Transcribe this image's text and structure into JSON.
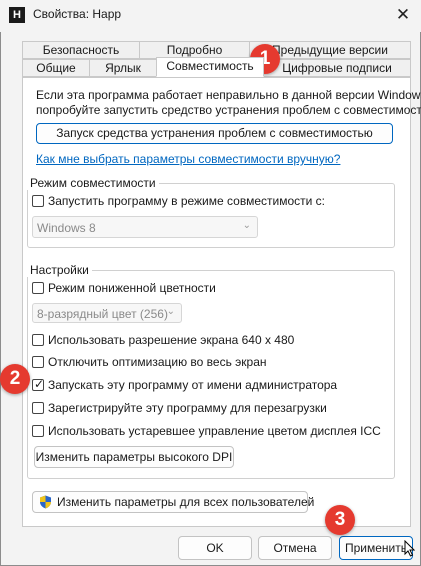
{
  "window": {
    "title": "Свойства: Happ",
    "app_icon_glyph": "H",
    "close_glyph": "✕"
  },
  "tabs": {
    "row_top": [
      {
        "label": "Безопасность"
      },
      {
        "label": "Подробно"
      },
      {
        "label": "Предыдущие версии"
      }
    ],
    "row_bottom": [
      {
        "label": "Общие"
      },
      {
        "label": "Ярлык"
      },
      {
        "label": "Совместимость"
      },
      {
        "label": "Цифровые подписи"
      }
    ]
  },
  "intro": {
    "line1": "Если эта программа работает неправильно в данной версии Windows,",
    "line2": "попробуйте запустить средство устранения проблем с совместимостью."
  },
  "troubleshooter_button": "Запуск средства устранения проблем с совместимостью",
  "help_link": "Как мне выбрать параметры совместимости вручную?",
  "compat_mode": {
    "legend": "Режим совместимости",
    "checkbox_label": "Запустить программу в режиме совместимости с:",
    "checked": false,
    "select_value": "Windows 8"
  },
  "settings": {
    "legend": "Настройки",
    "reduced_color": {
      "label": "Режим пониженной цветности",
      "checked": false
    },
    "color_select_value": "8-разрядный цвет (256)",
    "resolution_640": {
      "label": "Использовать разрешение экрана 640 x 480",
      "checked": false
    },
    "disable_fullscreen_opt": {
      "label": "Отключить оптимизацию во весь экран",
      "checked": false
    },
    "run_as_admin": {
      "label": "Запускать эту программу от имени администратора",
      "checked": true
    },
    "register_restart": {
      "label": "Зарегистрируйте эту программу для перезагрузки",
      "checked": false
    },
    "legacy_icc": {
      "label": "Использовать устаревшее управление цветом дисплея ICC",
      "checked": false
    },
    "high_dpi_button": "Изменить параметры высокого DPI"
  },
  "all_users_button": "Изменить параметры для всех пользователей",
  "footer": {
    "ok": "OK",
    "cancel": "Отмена",
    "apply": "Применить"
  },
  "annotations": {
    "badge1": "1",
    "badge2": "2",
    "badge3": "3",
    "badge_color": "#e53a2f"
  },
  "icons": {
    "shield": "uac-shield-icon",
    "check": "✓",
    "chevron": "⌄"
  }
}
